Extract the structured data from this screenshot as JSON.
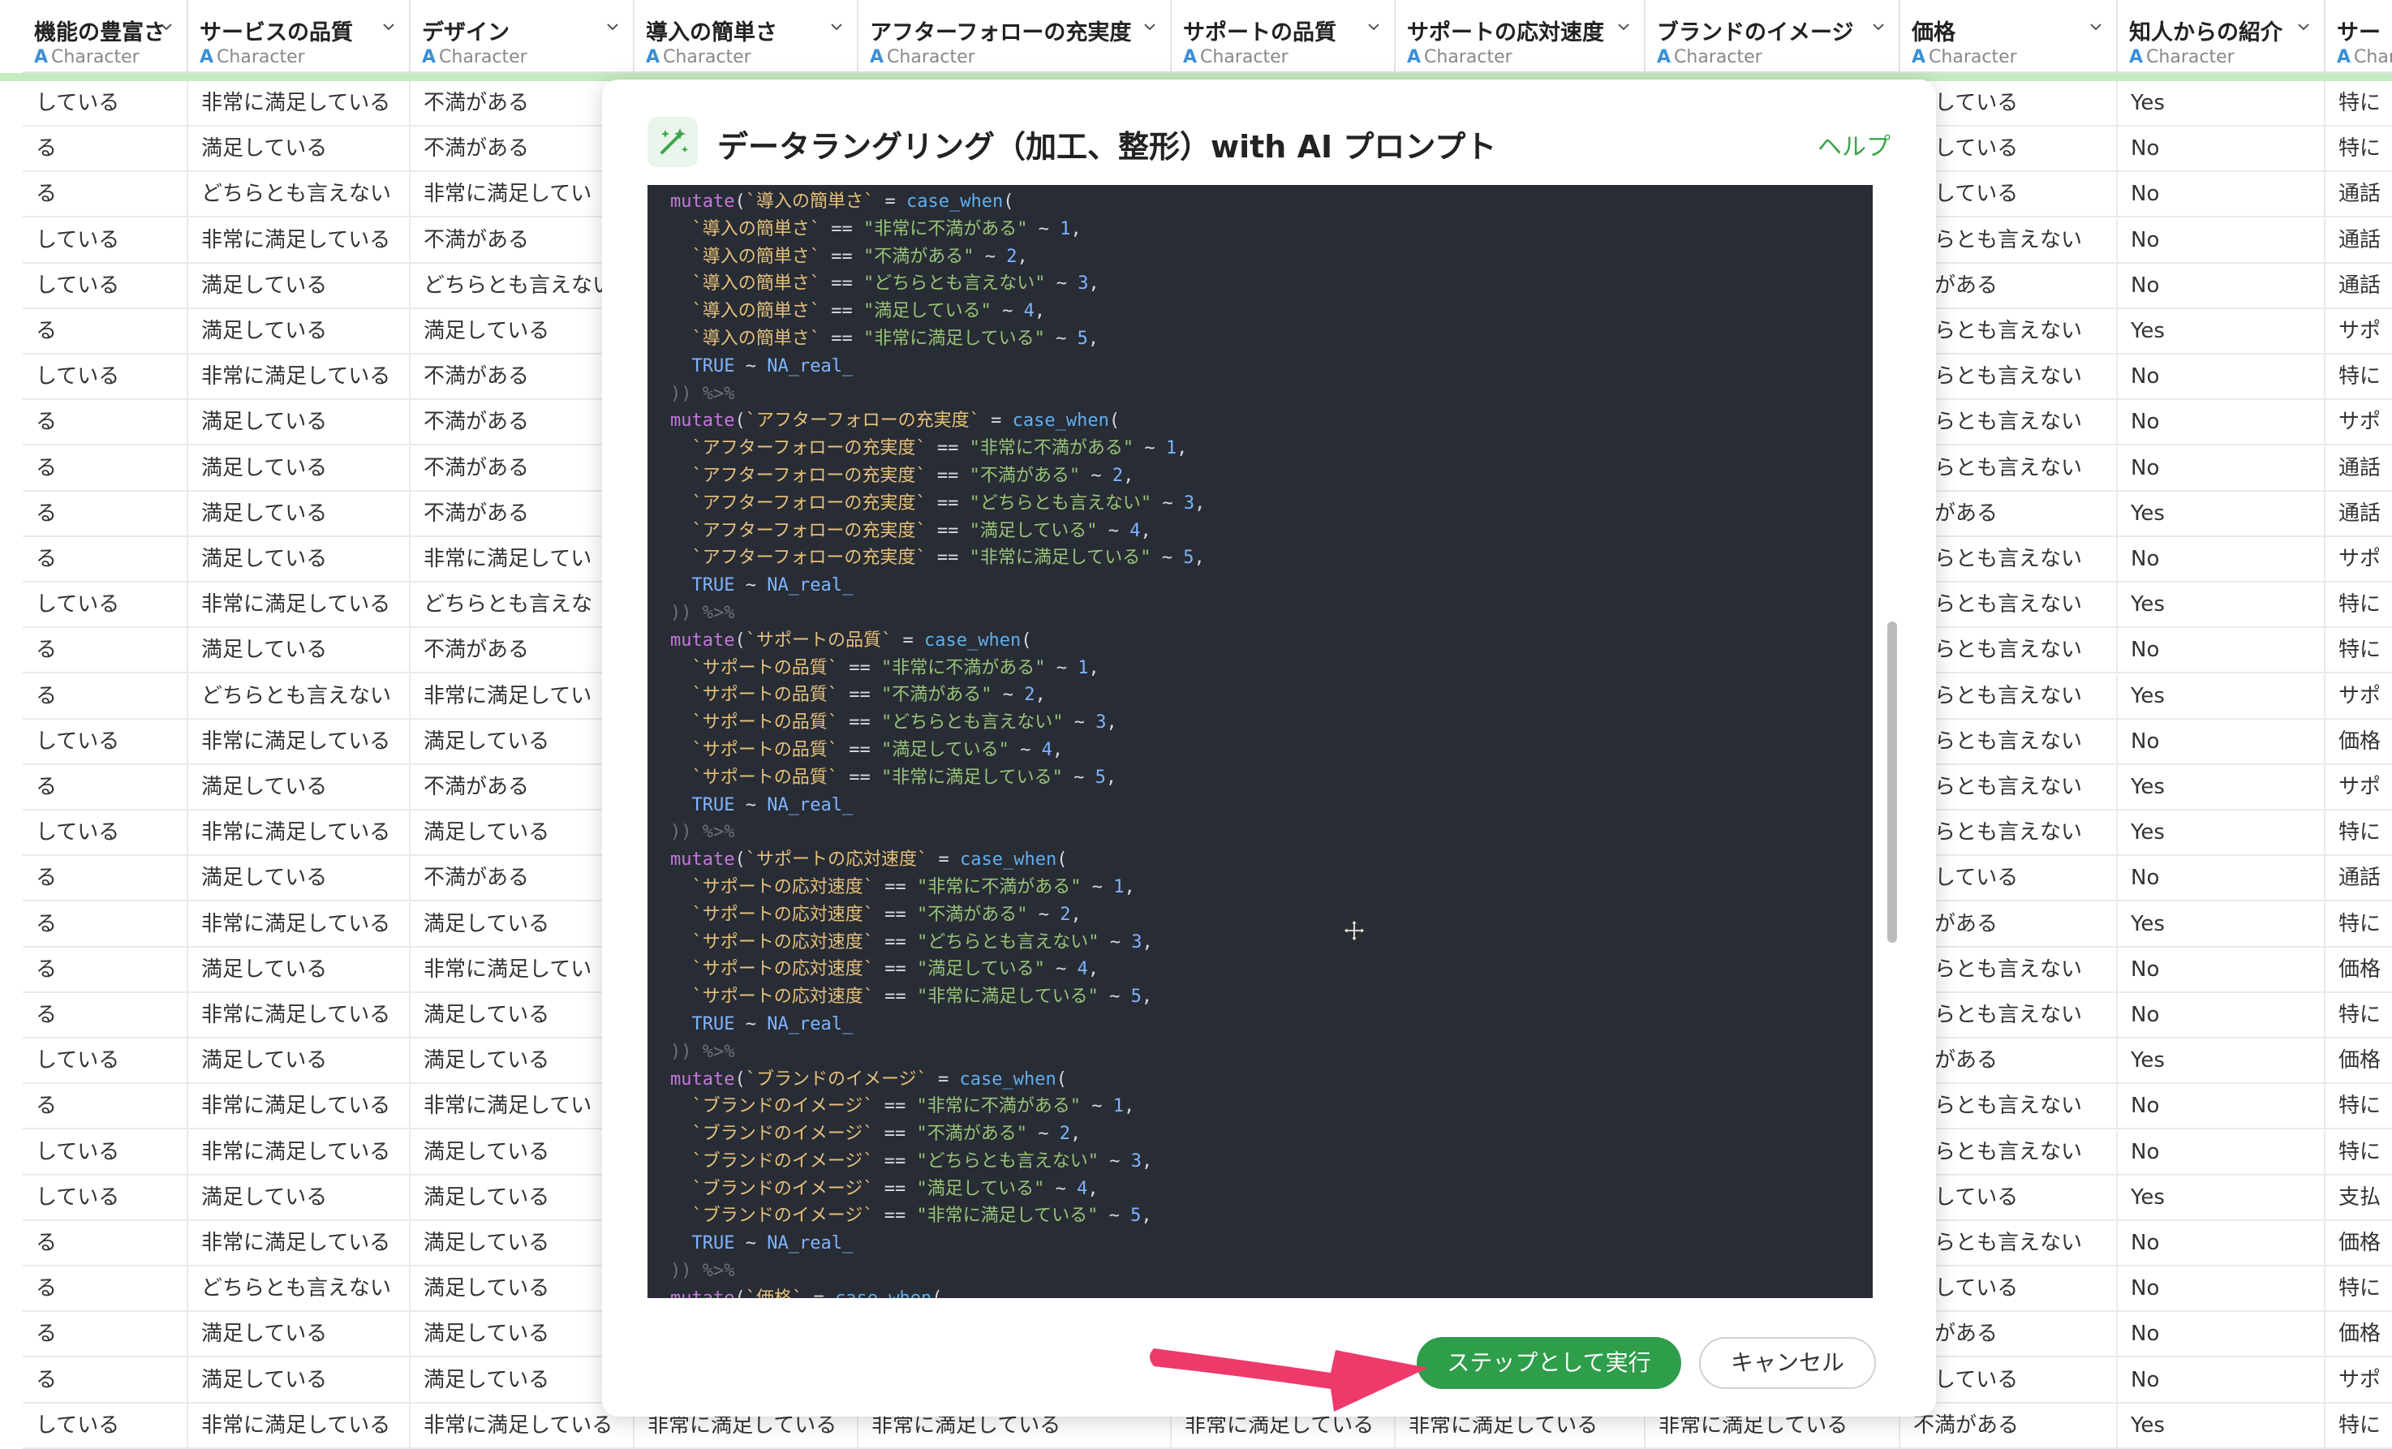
{
  "columns": [
    {
      "key": "c0",
      "name": "機能の豊富さ",
      "type": "Character"
    },
    {
      "key": "c1",
      "name": "サービスの品質",
      "type": "Character"
    },
    {
      "key": "c2",
      "name": "デザイン",
      "type": "Character"
    },
    {
      "key": "c3",
      "name": "導入の簡単さ",
      "type": "Character"
    },
    {
      "key": "c4",
      "name": "アフターフォローの充実度",
      "type": "Character"
    },
    {
      "key": "c5",
      "name": "サポートの品質",
      "type": "Character"
    },
    {
      "key": "c6",
      "name": "サポートの応対速度",
      "type": "Character"
    },
    {
      "key": "c7",
      "name": "ブランドのイメージ",
      "type": "Character"
    },
    {
      "key": "c8",
      "name": "価格",
      "type": "Character"
    },
    {
      "key": "c9",
      "name": "知人からの紹介",
      "type": "Character"
    },
    {
      "key": "c10",
      "name": "サー",
      "type": "Char"
    }
  ],
  "rows": [
    [
      "している",
      "非常に満足している",
      "不満がある",
      "",
      "",
      "",
      "",
      "",
      "足している",
      "Yes",
      "特に"
    ],
    [
      "る",
      "満足している",
      "不満がある",
      "",
      "",
      "",
      "",
      "",
      "足している",
      "No",
      "特に"
    ],
    [
      "る",
      "どちらとも言えない",
      "非常に満足してい",
      "",
      "",
      "",
      "",
      "",
      "足している",
      "No",
      "通話"
    ],
    [
      "している",
      "非常に満足している",
      "不満がある",
      "",
      "",
      "",
      "",
      "",
      "ちらとも言えない",
      "No",
      "通話"
    ],
    [
      "している",
      "満足している",
      "どちらとも言えない",
      "",
      "",
      "",
      "",
      "",
      "満がある",
      "No",
      "通話"
    ],
    [
      "る",
      "満足している",
      "満足している",
      "",
      "",
      "",
      "",
      "",
      "ちらとも言えない",
      "Yes",
      "サポ"
    ],
    [
      "している",
      "非常に満足している",
      "不満がある",
      "",
      "",
      "",
      "",
      "",
      "ちらとも言えない",
      "No",
      "特に"
    ],
    [
      "る",
      "満足している",
      "不満がある",
      "",
      "",
      "",
      "",
      "",
      "ちらとも言えない",
      "No",
      "サポ"
    ],
    [
      "る",
      "満足している",
      "不満がある",
      "",
      "",
      "",
      "",
      "",
      "ちらとも言えない",
      "No",
      "通話"
    ],
    [
      "る",
      "満足している",
      "不満がある",
      "",
      "",
      "",
      "",
      "",
      "満がある",
      "Yes",
      "通話"
    ],
    [
      "る",
      "満足している",
      "非常に満足してい",
      "",
      "",
      "",
      "",
      "",
      "ちらとも言えない",
      "No",
      "サポ"
    ],
    [
      "している",
      "非常に満足している",
      "どちらとも言えな",
      "",
      "",
      "",
      "",
      "",
      "ちらとも言えない",
      "Yes",
      "特に"
    ],
    [
      "る",
      "満足している",
      "不満がある",
      "",
      "",
      "",
      "",
      "",
      "ちらとも言えない",
      "No",
      "特に"
    ],
    [
      "る",
      "どちらとも言えない",
      "非常に満足してい",
      "",
      "",
      "",
      "",
      "",
      "ちらとも言えない",
      "Yes",
      "サポ"
    ],
    [
      "している",
      "非常に満足している",
      "満足している",
      "",
      "",
      "",
      "",
      "",
      "ちらとも言えない",
      "No",
      "価格"
    ],
    [
      "る",
      "満足している",
      "不満がある",
      "",
      "",
      "",
      "",
      "",
      "ちらとも言えない",
      "Yes",
      "サポ"
    ],
    [
      "している",
      "非常に満足している",
      "満足している",
      "",
      "",
      "",
      "",
      "",
      "ちらとも言えない",
      "Yes",
      "特に"
    ],
    [
      "る",
      "満足している",
      "不満がある",
      "",
      "",
      "",
      "",
      "",
      "足している",
      "No",
      "通話"
    ],
    [
      "る",
      "非常に満足している",
      "満足している",
      "",
      "",
      "",
      "",
      "",
      "満がある",
      "Yes",
      "特に"
    ],
    [
      "る",
      "満足している",
      "非常に満足してい",
      "",
      "",
      "",
      "",
      "",
      "ちらとも言えない",
      "No",
      "価格"
    ],
    [
      "る",
      "非常に満足している",
      "満足している",
      "",
      "",
      "",
      "",
      "",
      "ちらとも言えない",
      "No",
      "特に"
    ],
    [
      "している",
      "満足している",
      "満足している",
      "",
      "",
      "",
      "",
      "",
      "満がある",
      "Yes",
      "価格"
    ],
    [
      "る",
      "非常に満足している",
      "非常に満足してい",
      "",
      "",
      "",
      "",
      "",
      "ちらとも言えない",
      "No",
      "特に"
    ],
    [
      "している",
      "非常に満足している",
      "満足している",
      "",
      "",
      "",
      "",
      "",
      "ちらとも言えない",
      "No",
      "特に"
    ],
    [
      "している",
      "満足している",
      "満足している",
      "",
      "",
      "",
      "",
      "",
      "足している",
      "Yes",
      "支払"
    ],
    [
      "る",
      "非常に満足している",
      "満足している",
      "",
      "",
      "",
      "",
      "",
      "ちらとも言えない",
      "No",
      "価格"
    ],
    [
      "る",
      "どちらとも言えない",
      "満足している",
      "",
      "",
      "",
      "",
      "",
      "足している",
      "No",
      "特に"
    ],
    [
      "る",
      "満足している",
      "満足している",
      "",
      "",
      "",
      "",
      "",
      "満がある",
      "No",
      "価格"
    ],
    [
      "る",
      "満足している",
      "満足している",
      "",
      "",
      "",
      "",
      "",
      "足している",
      "No",
      "サポ"
    ],
    [
      "している",
      "非常に満足している",
      "非常に満足している",
      "非常に満足している",
      "非常に満足している",
      "非常に満足している",
      "非常に満足している",
      "非常に満足している",
      "不満がある",
      "Yes",
      "特に"
    ]
  ],
  "modal": {
    "title": "データラングリング（加工、整形）with AI プロンプト",
    "help": "ヘルプ",
    "run_label": "ステップとして実行",
    "cancel_label": "キャンセル"
  },
  "code_lines": [
    [
      "mutate(`導入の簡単さ` = case_when(",
      "k"
    ],
    [
      "  `導入の簡単さ` == \"非常に不満がある\" ~ 1,",
      "e"
    ],
    [
      "  `導入の簡単さ` == \"不満がある\" ~ 2,",
      "e"
    ],
    [
      "  `導入の簡単さ` == \"どちらとも言えない\" ~ 3,",
      "e"
    ],
    [
      "  `導入の簡単さ` == \"満足している\" ~ 4,",
      "e"
    ],
    [
      "  `導入の簡単さ` == \"非常に満足している\" ~ 5,",
      "e"
    ],
    [
      "  TRUE ~ NA_real_",
      "t"
    ],
    [
      ")) %>%",
      "c"
    ],
    [
      "mutate(`アフターフォローの充実度` = case_when(",
      "k"
    ],
    [
      "  `アフターフォローの充実度` == \"非常に不満がある\" ~ 1,",
      "e"
    ],
    [
      "  `アフターフォローの充実度` == \"不満がある\" ~ 2,",
      "e"
    ],
    [
      "  `アフターフォローの充実度` == \"どちらとも言えない\" ~ 3,",
      "e"
    ],
    [
      "  `アフターフォローの充実度` == \"満足している\" ~ 4,",
      "e"
    ],
    [
      "  `アフターフォローの充実度` == \"非常に満足している\" ~ 5,",
      "e"
    ],
    [
      "  TRUE ~ NA_real_",
      "t"
    ],
    [
      ")) %>%",
      "c"
    ],
    [
      "mutate(`サポートの品質` = case_when(",
      "k"
    ],
    [
      "  `サポートの品質` == \"非常に不満がある\" ~ 1,",
      "e"
    ],
    [
      "  `サポートの品質` == \"不満がある\" ~ 2,",
      "e"
    ],
    [
      "  `サポートの品質` == \"どちらとも言えない\" ~ 3,",
      "e"
    ],
    [
      "  `サポートの品質` == \"満足している\" ~ 4,",
      "e"
    ],
    [
      "  `サポートの品質` == \"非常に満足している\" ~ 5,",
      "e"
    ],
    [
      "  TRUE ~ NA_real_",
      "t"
    ],
    [
      ")) %>%",
      "c"
    ],
    [
      "mutate(`サポートの応対速度` = case_when(",
      "k"
    ],
    [
      "  `サポートの応対速度` == \"非常に不満がある\" ~ 1,",
      "e"
    ],
    [
      "  `サポートの応対速度` == \"不満がある\" ~ 2,",
      "e"
    ],
    [
      "  `サポートの応対速度` == \"どちらとも言えない\" ~ 3,",
      "e"
    ],
    [
      "  `サポートの応対速度` == \"満足している\" ~ 4,",
      "e"
    ],
    [
      "  `サポートの応対速度` == \"非常に満足している\" ~ 5,",
      "e"
    ],
    [
      "  TRUE ~ NA_real_",
      "t"
    ],
    [
      ")) %>%",
      "c"
    ],
    [
      "mutate(`ブランドのイメージ` = case_when(",
      "k"
    ],
    [
      "  `ブランドのイメージ` == \"非常に不満がある\" ~ 1,",
      "e"
    ],
    [
      "  `ブランドのイメージ` == \"不満がある\" ~ 2,",
      "e"
    ],
    [
      "  `ブランドのイメージ` == \"どちらとも言えない\" ~ 3,",
      "e"
    ],
    [
      "  `ブランドのイメージ` == \"満足している\" ~ 4,",
      "e"
    ],
    [
      "  `ブランドのイメージ` == \"非常に満足している\" ~ 5,",
      "e"
    ],
    [
      "  TRUE ~ NA_real_",
      "t"
    ],
    [
      ")) %>%",
      "c"
    ],
    [
      "mutate(`価格` = case_when(",
      "k"
    ]
  ],
  "colors": {
    "accent": "#2e9e4a",
    "arrow": "#ee3a6a",
    "code_bg": "#282c34"
  }
}
